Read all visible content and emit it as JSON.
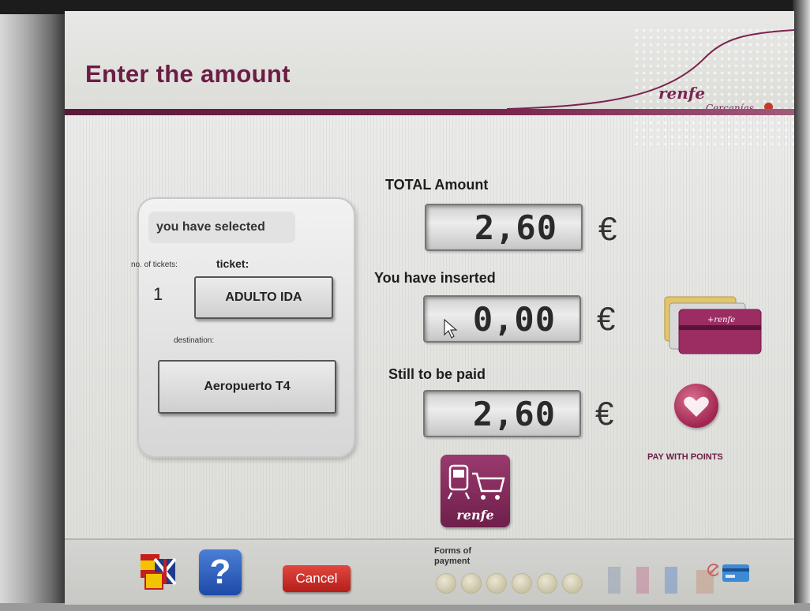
{
  "header": {
    "title": "Enter the amount",
    "brand": "renfe",
    "brand_sub": "Cercanías"
  },
  "selection": {
    "heading": "you have selected",
    "tickets_label": "no. of tickets:",
    "ticket_label": "ticket:",
    "quantity": "1",
    "ticket_type": "ADULTO IDA",
    "destination_label": "destination:",
    "destination": "Aeropuerto T4"
  },
  "amounts": {
    "total_label": "TOTAL Amount",
    "total_value": "2,60",
    "inserted_label": "You have inserted",
    "inserted_value": "0,00",
    "remaining_label": "Still to be paid",
    "remaining_value": "2,60",
    "currency": "€"
  },
  "actions": {
    "pay_points_label": "PAY WITH POINTS",
    "cart_label": "renfe"
  },
  "footer": {
    "help_symbol": "?",
    "cancel_label": "Cancel",
    "forms_of_payment_line1": "Forms of",
    "forms_of_payment_line2": "payment"
  },
  "colors": {
    "brand": "#6b1d44",
    "cancel": "#c7261f",
    "help": "#2a5bbf"
  },
  "icons": [
    "language-flags-icon",
    "help-icon",
    "ticket-cart-icon",
    "cards-icon",
    "heart-points-icon",
    "coin-icon",
    "banknote-icon",
    "credit-card-icon"
  ]
}
